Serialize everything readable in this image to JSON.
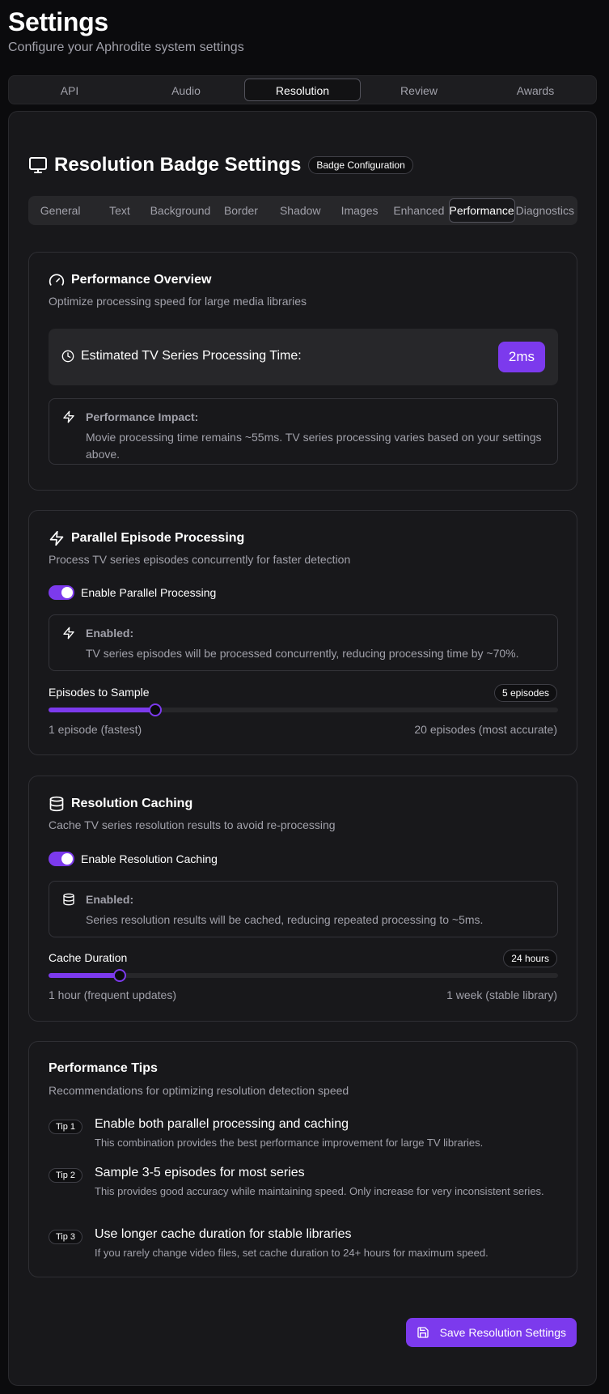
{
  "page": {
    "title": "Settings",
    "subtitle": "Configure your Aphrodite system settings"
  },
  "main_tabs": [
    {
      "label": "API"
    },
    {
      "label": "Audio"
    },
    {
      "label": "Resolution",
      "active": true
    },
    {
      "label": "Review"
    },
    {
      "label": "Awards"
    }
  ],
  "badge": {
    "icon": "monitor-icon",
    "title": "Resolution Badge Settings",
    "pill": "Badge Configuration"
  },
  "sub_tabs": [
    {
      "label": "General"
    },
    {
      "label": "Text"
    },
    {
      "label": "Background"
    },
    {
      "label": "Border"
    },
    {
      "label": "Shadow"
    },
    {
      "label": "Images"
    },
    {
      "label": "Enhanced"
    },
    {
      "label": "Performance",
      "active": true
    },
    {
      "label": "Diagnostics"
    }
  ],
  "overview": {
    "icon": "gauge-icon",
    "title": "Performance Overview",
    "desc": "Optimize processing speed for large media libraries",
    "estimate_label": "Estimated TV Series Processing Time:",
    "estimate_value": "2ms",
    "impact_title": "Performance Impact:",
    "impact_text": "Movie processing time remains ~55ms. TV series processing varies based on your settings above."
  },
  "parallel": {
    "icon": "zap-icon",
    "title": "Parallel Episode Processing",
    "desc": "Process TV series episodes concurrently for faster detection",
    "toggle_label": "Enable Parallel Processing",
    "toggle_on": true,
    "info_title": "Enabled:",
    "info_text": "TV series episodes will be processed concurrently, reducing processing time by ~70%.",
    "slider_label": "Episodes to Sample",
    "slider_value": "5 episodes",
    "slider_fraction": 0.21,
    "slider_min": "1 episode (fastest)",
    "slider_max": "20 episodes (most accurate)"
  },
  "caching": {
    "icon": "database-icon",
    "title": "Resolution Caching",
    "desc": "Cache TV series resolution results to avoid re-processing",
    "toggle_label": "Enable Resolution Caching",
    "toggle_on": true,
    "info_title": "Enabled:",
    "info_text": "Series resolution results will be cached, reducing repeated processing to ~5ms.",
    "slider_label": "Cache Duration",
    "slider_value": "24 hours",
    "slider_fraction": 0.14,
    "slider_min": "1 hour (frequent updates)",
    "slider_max": "1 week (stable library)"
  },
  "tips": {
    "title": "Performance Tips",
    "desc": "Recommendations for optimizing resolution detection speed",
    "items": [
      {
        "badge": "Tip 1",
        "title": "Enable both parallel processing and caching",
        "text": "This combination provides the best performance improvement for large TV libraries."
      },
      {
        "badge": "Tip 2",
        "title": "Sample 3-5 episodes for most series",
        "text": "This provides good accuracy while maintaining speed. Only increase for very inconsistent series."
      },
      {
        "badge": "Tip 3",
        "title": "Use longer cache duration for stable libraries",
        "text": "If you rarely change video files, set cache duration to 24+ hours for maximum speed."
      }
    ]
  },
  "save_button": {
    "label": "Save Resolution Settings",
    "icon": "save-icon"
  },
  "colors": {
    "accent": "#7c3aed",
    "background": "#0b0b0d",
    "card": "#18181b"
  }
}
